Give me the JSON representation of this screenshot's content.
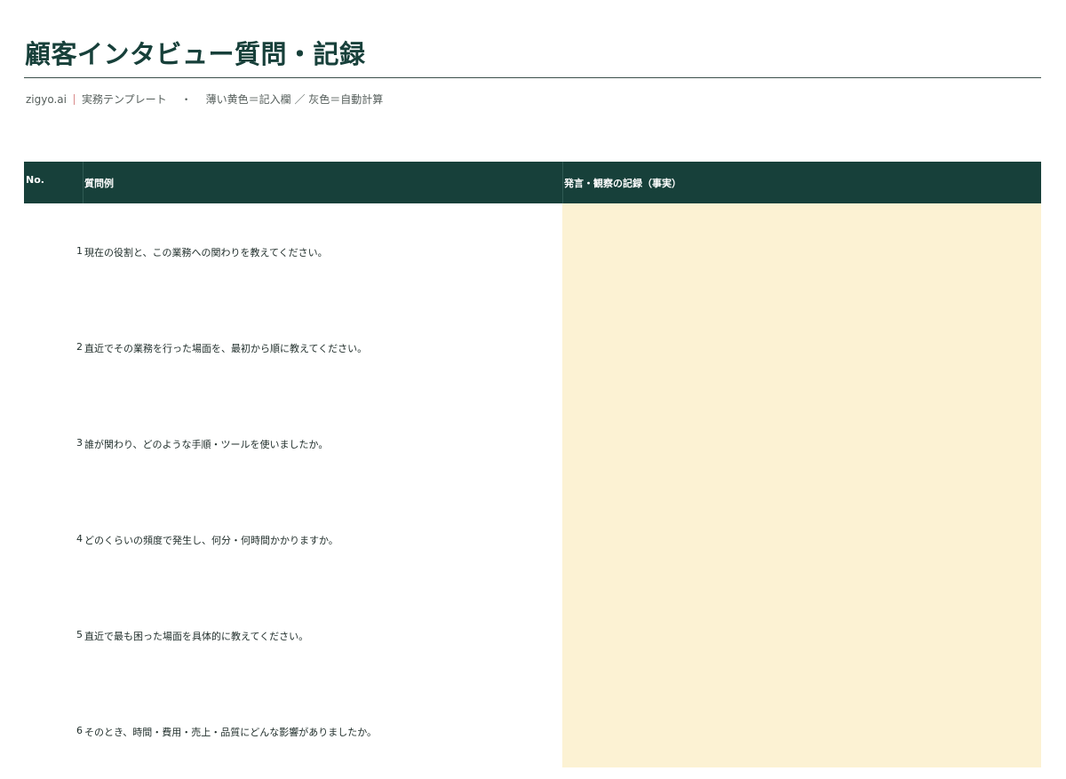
{
  "header": {
    "title": "顧客インタビュー質問・記録",
    "brand": "zigyo.ai",
    "template_type": "実務テンプレート",
    "bullet": "・",
    "legend": "薄い黄色＝記入欄 ／ 灰色＝自動計算"
  },
  "table": {
    "columns": [
      "No.",
      "質問例",
      "発言・観察の記録（事実）"
    ],
    "rows": [
      {
        "no": "1",
        "question": "現在の役割と、この業務への関わりを教えてください。",
        "record": ""
      },
      {
        "no": "2",
        "question": "直近でその業務を行った場面を、最初から順に教えてください。",
        "record": ""
      },
      {
        "no": "3",
        "question": "誰が関わり、どのような手順・ツールを使いましたか。",
        "record": ""
      },
      {
        "no": "4",
        "question": "どのくらいの頻度で発生し、何分・何時間かかりますか。",
        "record": ""
      },
      {
        "no": "5",
        "question": "直近で最も困った場面を具体的に教えてください。",
        "record": ""
      },
      {
        "no": "6",
        "question": "そのとき、時間・費用・売上・品質にどんな影響がありましたか。",
        "record": ""
      }
    ]
  },
  "colors": {
    "header_bg": "#17403a",
    "input_fill": "#fcf2d3",
    "title": "#17403a"
  }
}
